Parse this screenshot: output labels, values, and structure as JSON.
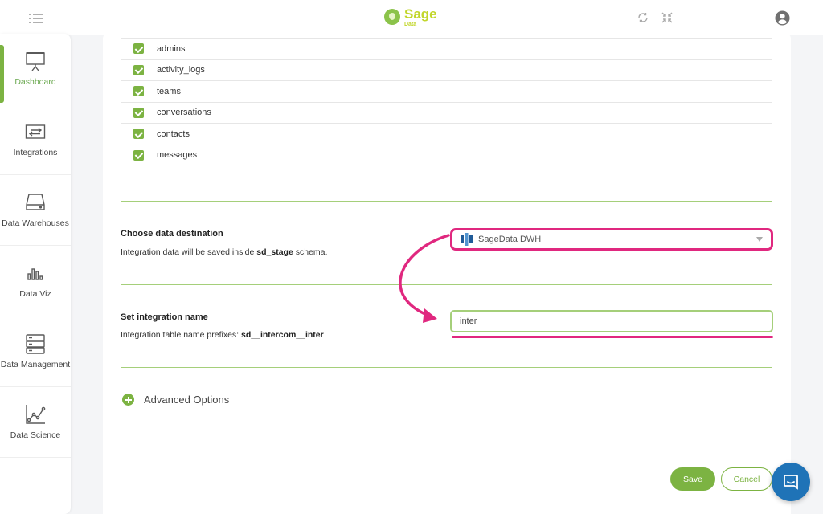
{
  "app": {
    "logo_name": "Sage",
    "logo_sub": "Data"
  },
  "sidebar": {
    "items": [
      {
        "label": "Dashboard",
        "icon": "presentation-board-icon",
        "active": true
      },
      {
        "label": "Integrations",
        "icon": "transfer-arrows-icon"
      },
      {
        "label": "Data Warehouses",
        "icon": "hard-drive-icon"
      },
      {
        "label": "Data Viz",
        "icon": "bar-chart-icon"
      },
      {
        "label": "Data Management",
        "icon": "server-icon"
      },
      {
        "label": "Data Science",
        "icon": "line-chart-icon"
      }
    ]
  },
  "tables": {
    "items": [
      {
        "label": "admins",
        "checked": true
      },
      {
        "label": "activity_logs",
        "checked": true
      },
      {
        "label": "teams",
        "checked": true
      },
      {
        "label": "conversations",
        "checked": true
      },
      {
        "label": "contacts",
        "checked": true
      },
      {
        "label": "messages",
        "checked": true
      }
    ]
  },
  "destination": {
    "title": "Choose data destination",
    "desc_prefix": "Integration data will be saved inside ",
    "desc_bold": "sd_stage",
    "desc_suffix": " schema.",
    "selected": "SageData DWH"
  },
  "integration_name": {
    "title": "Set integration name",
    "desc_prefix": "Integration table name prefixes: ",
    "desc_bold": "sd__intercom__inter",
    "value": "inter"
  },
  "advanced": {
    "label": "Advanced Options"
  },
  "actions": {
    "save_label": "Save",
    "cancel_label": "Cancel"
  },
  "colors": {
    "accent": "#7cb342",
    "highlight": "#e0287f",
    "chat": "#1f73b7"
  }
}
